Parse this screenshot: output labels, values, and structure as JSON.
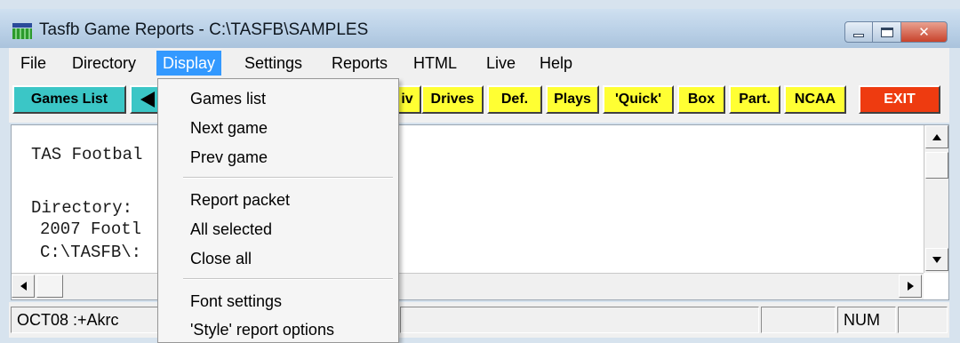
{
  "window": {
    "title": "Tasfb Game Reports - C:\\TASFB\\SAMPLES"
  },
  "menubar": {
    "items": [
      "File",
      "Directory",
      "Display",
      "Settings",
      "Reports",
      "HTML",
      "Live",
      "Help"
    ],
    "active": "Display"
  },
  "toolbar": {
    "games_list": "Games List",
    "prev_arrow_icon": "left-triangle-icon",
    "buttons": [
      "iv",
      "Drives",
      "Def.",
      "Plays",
      "'Quick'",
      "Box",
      "Part.",
      "NCAA"
    ],
    "exit": "EXIT"
  },
  "colors": {
    "toolbar_yellow": "#ffff33",
    "toolbar_teal": "#3bc6c6",
    "exit_red": "#ee3b10",
    "menu_highlight": "#3399ff"
  },
  "content": {
    "lines": [
      "TAS Footbal",
      "Directory:",
      "2007 Footl",
      "C:\\TASFB\\:"
    ]
  },
  "statusbar": {
    "left": "OCT08  :+Akrc",
    "right": "NUM"
  },
  "display_menu": {
    "group1": [
      "Games list",
      "Next game",
      "Prev game"
    ],
    "group2": [
      "Report packet",
      "All selected",
      "Close all"
    ],
    "group3": [
      "Font settings",
      "'Style' report options"
    ]
  }
}
